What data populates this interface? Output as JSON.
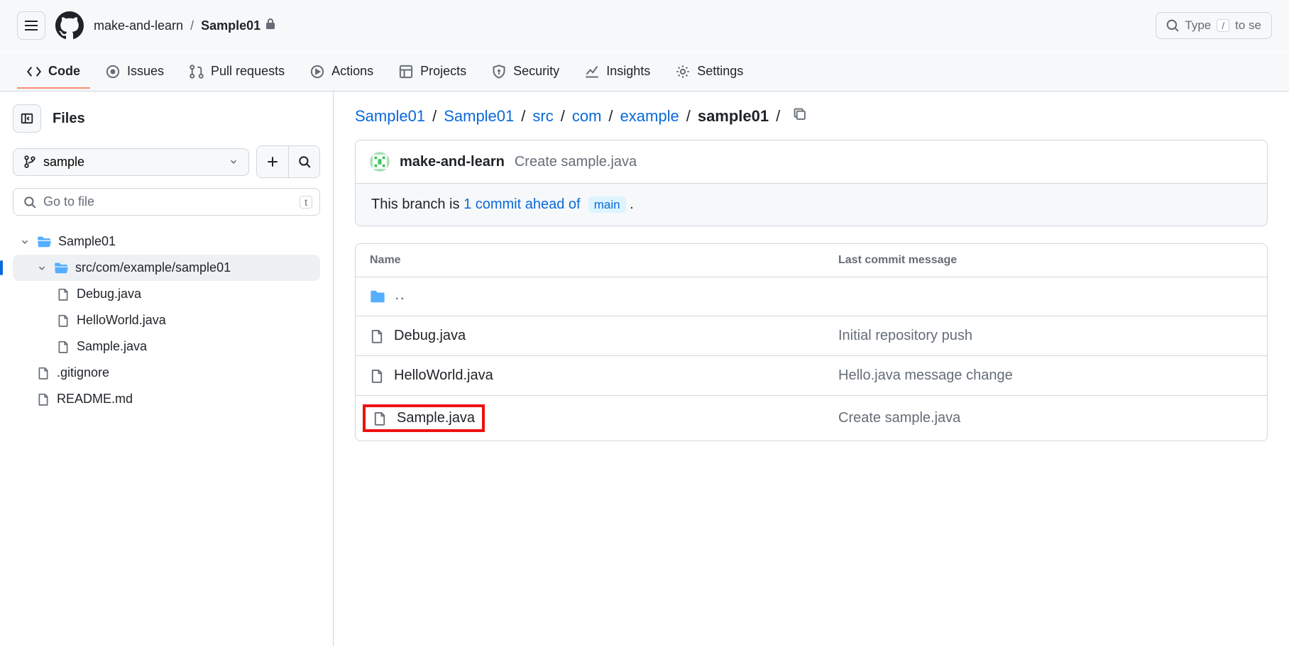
{
  "header": {
    "owner": "make-and-learn",
    "repo": "Sample01",
    "search_placeholder": "Type",
    "search_suffix": "to se",
    "search_key": "/"
  },
  "nav": {
    "code": "Code",
    "issues": "Issues",
    "pulls": "Pull requests",
    "actions": "Actions",
    "projects": "Projects",
    "security": "Security",
    "insights": "Insights",
    "settings": "Settings"
  },
  "sidebar": {
    "title": "Files",
    "branch": "sample",
    "goto_placeholder": "Go to file",
    "goto_key": "t",
    "tree": {
      "root": "Sample01",
      "folder": "src/com/example/sample01",
      "files": [
        "Debug.java",
        "HelloWorld.java",
        "Sample.java"
      ],
      "root_files": [
        ".gitignore",
        "README.md"
      ]
    }
  },
  "path": {
    "segments": [
      "Sample01",
      "Sample01",
      "src",
      "com",
      "example"
    ],
    "current": "sample01"
  },
  "commit": {
    "author": "make-and-learn",
    "message": "Create sample.java"
  },
  "notice": {
    "prefix": "This branch is ",
    "link": "1 commit ahead of",
    "branch": "main",
    "suffix": "."
  },
  "table": {
    "head_name": "Name",
    "head_msg": "Last commit message",
    "parent": "..",
    "rows": [
      {
        "name": "Debug.java",
        "msg": "Initial repository push",
        "highlight": false
      },
      {
        "name": "HelloWorld.java",
        "msg": "Hello.java message change",
        "highlight": false
      },
      {
        "name": "Sample.java",
        "msg": "Create sample.java",
        "highlight": true
      }
    ]
  }
}
